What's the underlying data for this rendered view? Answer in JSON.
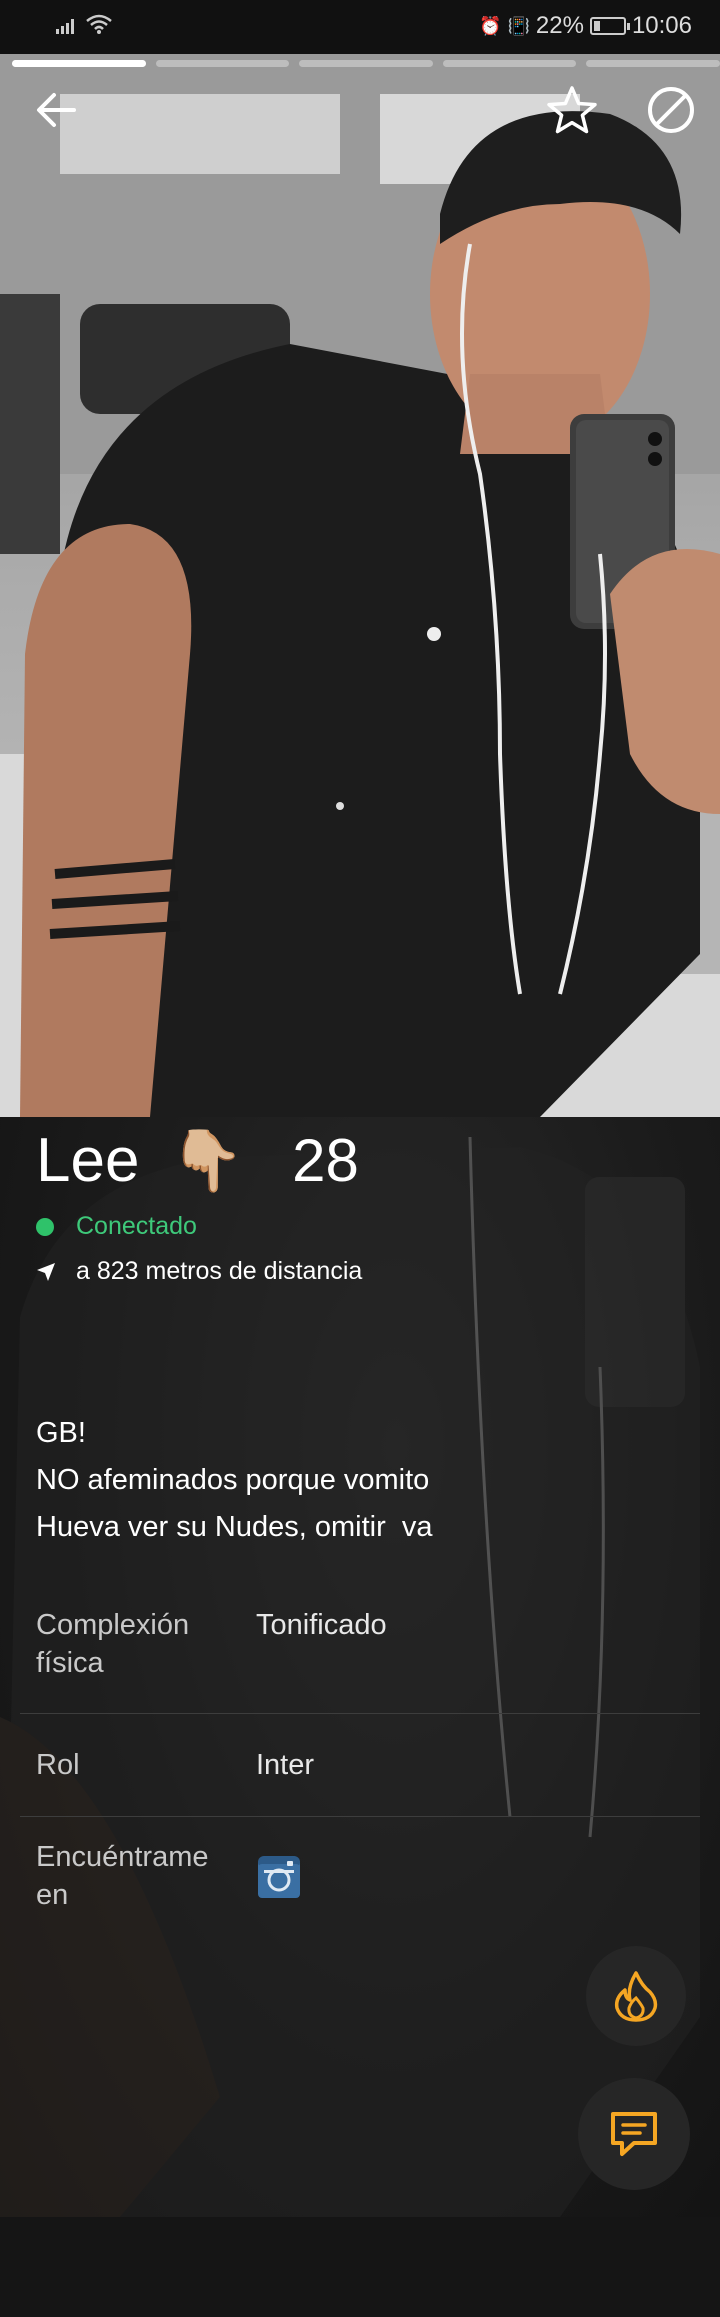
{
  "status_bar": {
    "battery_percent": "22%",
    "battery_level": 0.22,
    "time": "10:06"
  },
  "story": {
    "count": 5,
    "active_index": 0
  },
  "profile": {
    "name": "Lee",
    "emoji": "👇🏼",
    "age": "28",
    "online_status": "Conectado",
    "distance": "a 823 metros de distancia",
    "bio_lines": [
      "GB!",
      "NO afeminados porque vomito",
      "Hueva ver su Nudes, omitir  va"
    ]
  },
  "stats": {
    "body_type": {
      "label_line1": "Complexión",
      "label_line2": "física",
      "value": "Tonificado"
    },
    "role": {
      "label": "Rol",
      "value": "Inter"
    },
    "find_me": {
      "label_line1": "Encuéntrame",
      "label_line2": "en"
    }
  },
  "colors": {
    "online_green": "#2fc26a",
    "accent_orange": "#f5a623",
    "instagram_blue": "#3a6fa3"
  },
  "icons": {
    "back": "back-arrow-icon",
    "favorite": "star-icon",
    "block": "block-icon",
    "location": "location-arrow-icon",
    "instagram": "instagram-icon",
    "tap": "flame-icon",
    "chat": "chat-icon"
  }
}
